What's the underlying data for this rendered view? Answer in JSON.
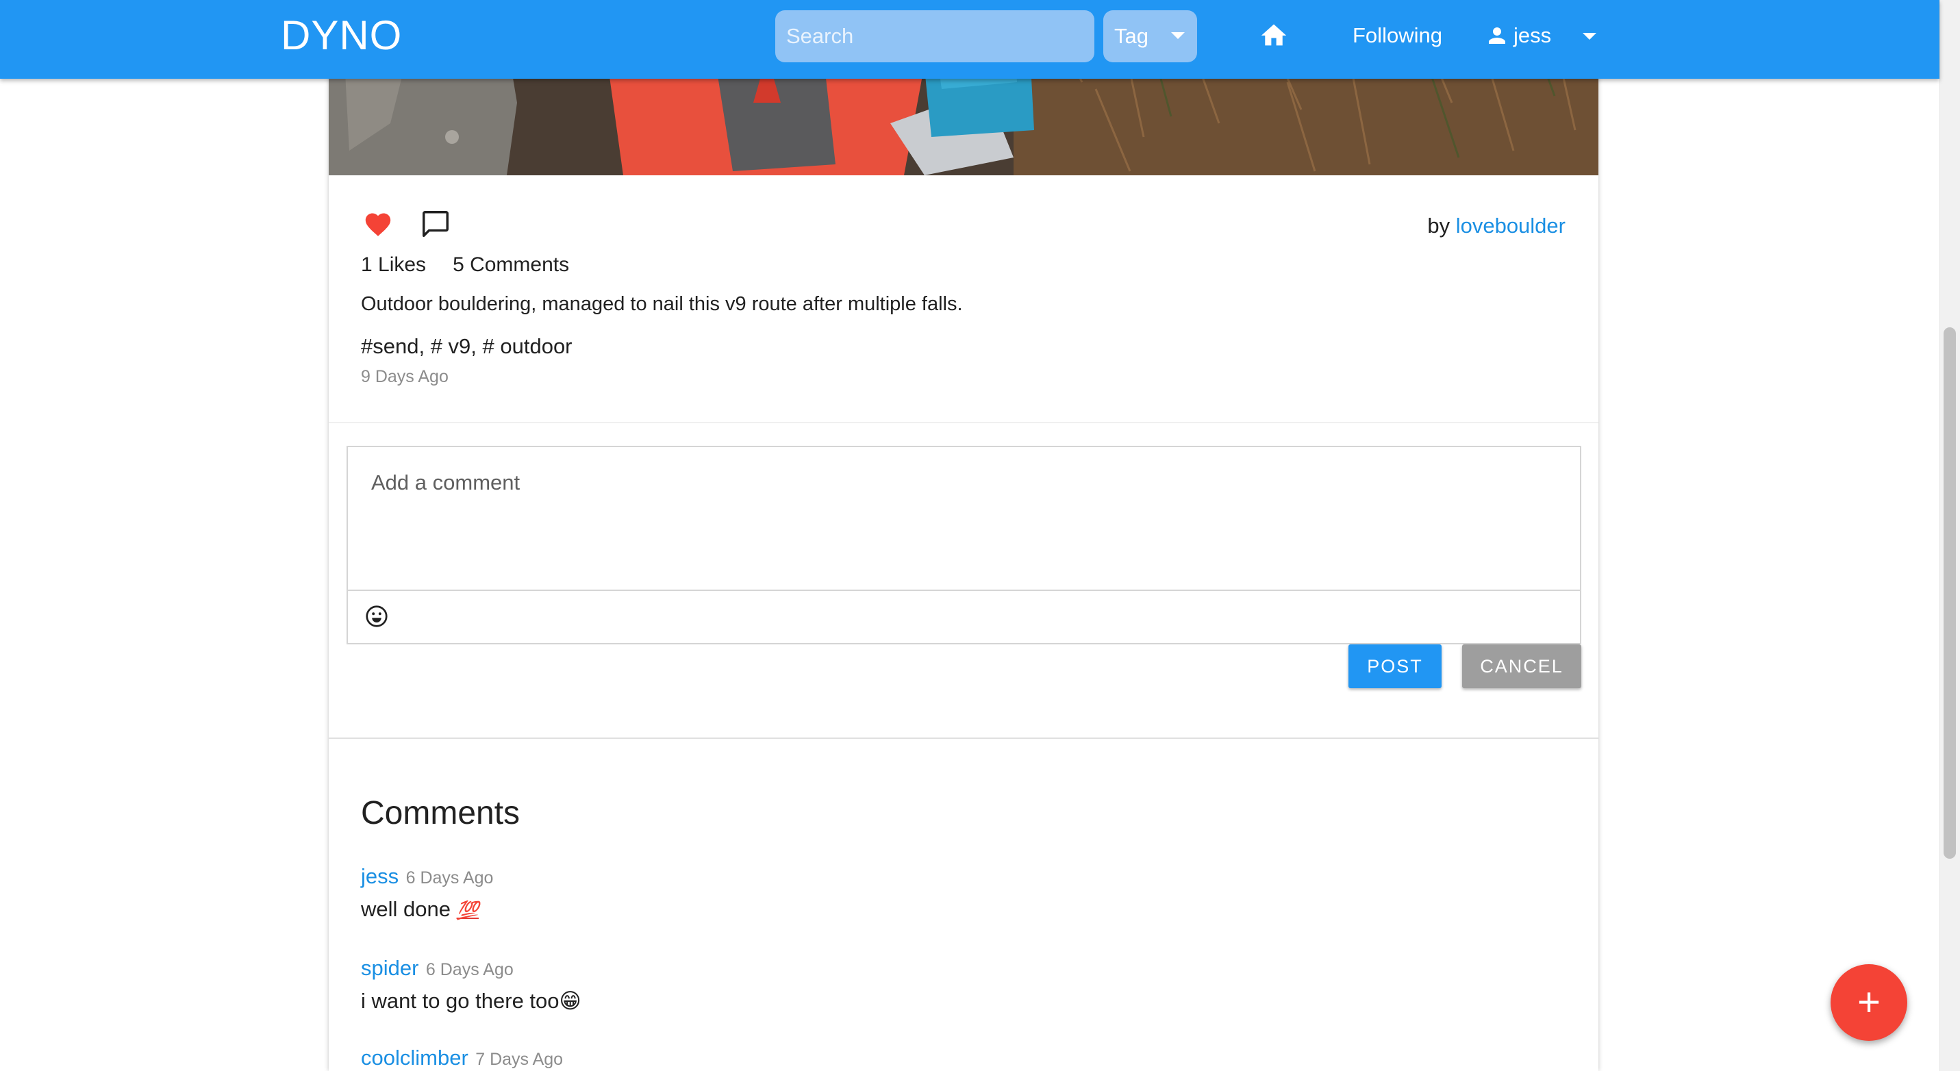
{
  "header": {
    "brand": "DYNO",
    "search_placeholder": "Search",
    "tag_label": "Tag",
    "following_label": "Following",
    "username": "jess",
    "color": "#2196f3"
  },
  "post": {
    "by_prefix": "by",
    "author": "loveboulder",
    "likes_label": "1 Likes",
    "comments_label": "5 Comments",
    "caption": "Outdoor bouldering, managed to nail this v9 route after multiple falls.",
    "hashtags": "#send, # v9, # outdoor",
    "date": "9 Days Ago",
    "liked": true
  },
  "comment_form": {
    "placeholder": "Add a comment",
    "post_label": "POST",
    "cancel_label": "CANCEL"
  },
  "comments_section": {
    "title": "Comments",
    "items": [
      {
        "user": "jess",
        "date": "6 Days Ago",
        "text": "well done ",
        "emoji": "💯"
      },
      {
        "user": "spider",
        "date": "6 Days Ago",
        "text": "i want to go there too",
        "emoji": "😁"
      },
      {
        "user": "coolclimber",
        "date": "7 Days Ago",
        "text": "",
        "emoji": ""
      }
    ]
  },
  "fab": {
    "label": "+",
    "color": "#f44336"
  }
}
